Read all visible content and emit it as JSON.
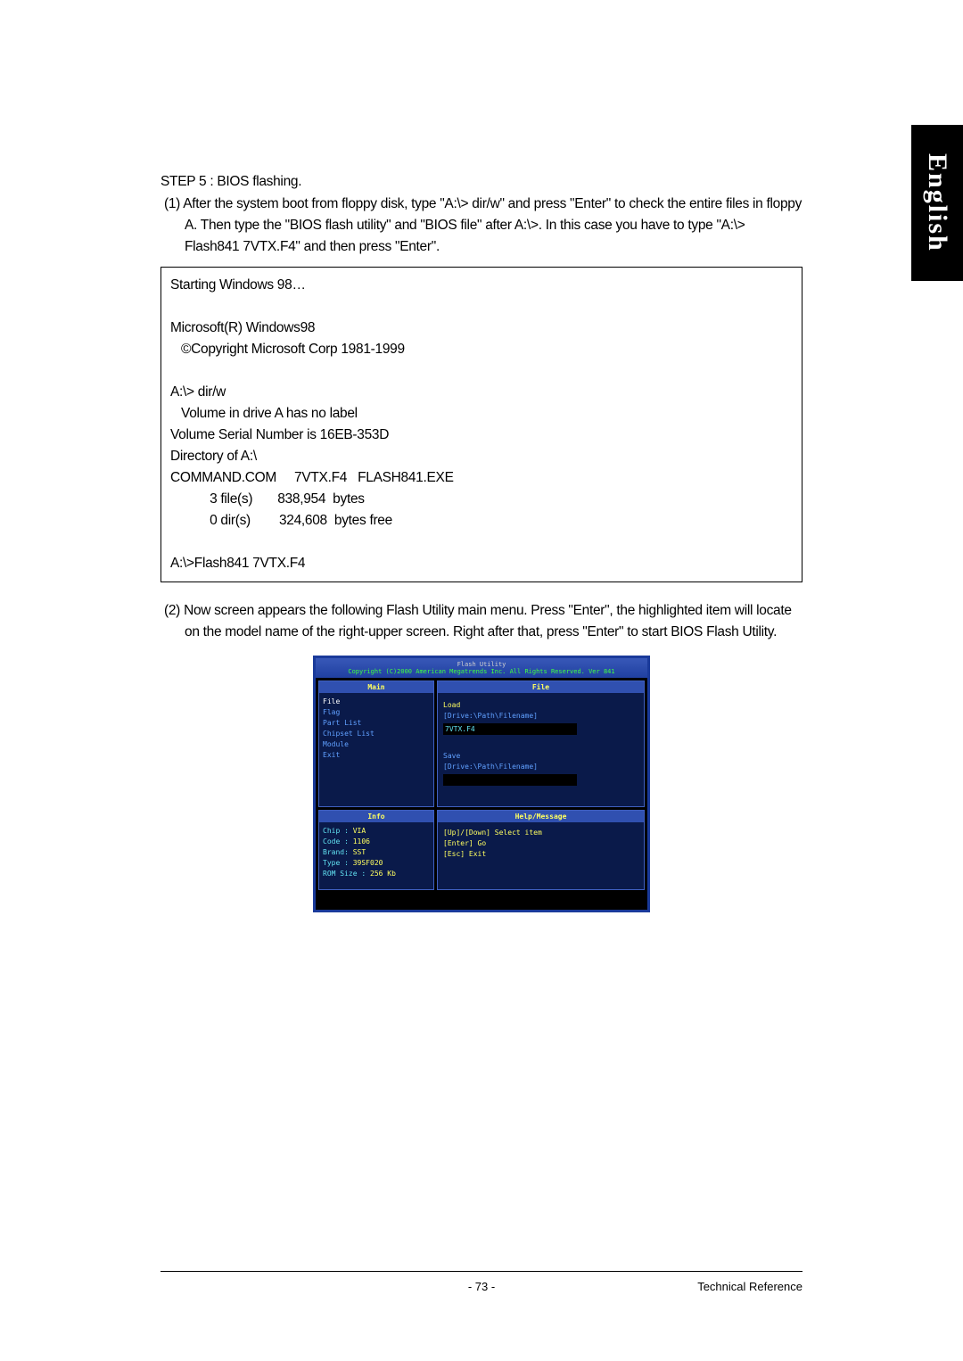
{
  "step5": {
    "title": "STEP 5 : BIOS flashing.",
    "instruction_num": "(1)",
    "instruction_text": "After the system boot from floppy disk, type \"A:\\> dir/w\" and press \"Enter\" to check the entire files in floppy A.  Then type the \"BIOS flash utility\" and \"BIOS file\" after A:\\>.  In this case you have to type \"A:\\> Flash841 7VTX.F4\" and then press \"Enter\"."
  },
  "terminal": {
    "line1": "Starting Windows 98…",
    "line2": "Microsoft(R) Windows98",
    "line3": "   ©Copyright Microsoft Corp 1981-1999",
    "line4": "A:\\> dir/w",
    "line5": "   Volume in drive A has no label",
    "line6": "Volume Serial Number is 16EB-353D",
    "line7": "Directory of A:\\",
    "line8": "COMMAND.COM     7VTX.F4   FLASH841.EXE",
    "line9": "           3 file(s)       838,954  bytes",
    "line10": "           0 dir(s)        324,608  bytes free",
    "line11": "A:\\>Flash841 7VTX.F4"
  },
  "step2": {
    "num": "(2)",
    "text": "Now screen appears the following Flash Utility main menu. Press \"Enter\", the highlighted item will locate on the model name of the right-upper screen. Right after that, press \"Enter\" to start BIOS Flash Utility."
  },
  "bios": {
    "title_top": "Flash Utility",
    "title_bottom": "Copyright (C)2000 American Megatrends Inc. All Rights Reserved. Ver 841",
    "main_header": "Main",
    "file_header": "File",
    "info_header": "Info",
    "help_header": "Help/Message",
    "menu_file": "File",
    "menu_flag": "Flag",
    "menu_part": "Part List",
    "menu_chipset": "Chipset List",
    "menu_module": "Module",
    "menu_exit": "Exit",
    "file_load": "Load",
    "file_load_path": "[Drive:\\Path\\Filename]",
    "file_input_val": "7VTX.F4",
    "file_save": "Save",
    "file_save_path": "[Drive:\\Path\\Filename]",
    "info_chip": "Chip :",
    "info_chip_val": "VIA",
    "info_code": "Code :",
    "info_code_val": "1106",
    "info_brand": "Brand:",
    "info_brand_val": "SST",
    "info_type": "Type :",
    "info_type_val": "39SF020",
    "info_rom": "ROM Size :",
    "info_rom_val": "256 Kb",
    "help1": "[Up]/[Down] Select item",
    "help2": "[Enter] Go",
    "help3": "[Esc] Exit"
  },
  "footer": {
    "page": "- 73 -",
    "right": "Technical Reference"
  },
  "tab": {
    "label": "English"
  }
}
